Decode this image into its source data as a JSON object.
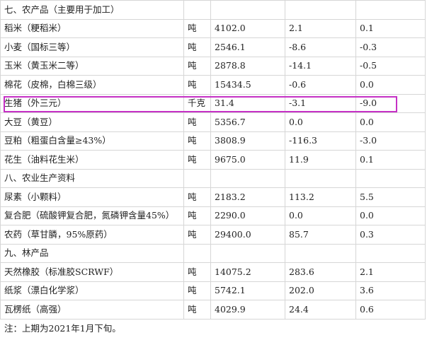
{
  "highlight_color": "#c530c5",
  "rows": [
    {
      "type": "section",
      "name": "七、农产品（主要用于加工）"
    },
    {
      "type": "item",
      "name": "稻米（粳稻米）",
      "unit": "吨",
      "price": "4102.0",
      "change": "2.1",
      "pct": "0.1"
    },
    {
      "type": "item",
      "name": "小麦（国标三等）",
      "unit": "吨",
      "price": "2546.1",
      "change": "-8.6",
      "pct": "-0.3"
    },
    {
      "type": "item",
      "name": "玉米（黄玉米二等）",
      "unit": "吨",
      "price": "2878.8",
      "change": "-14.1",
      "pct": "-0.5"
    },
    {
      "type": "item",
      "name": "棉花（皮棉，白棉三级）",
      "unit": "吨",
      "price": "15434.5",
      "change": "-0.6",
      "pct": "0.0"
    },
    {
      "type": "item",
      "name": "生猪（外三元）",
      "unit": "千克",
      "price": "31.4",
      "change": "-3.1",
      "pct": "-9.0",
      "highlighted": true
    },
    {
      "type": "item",
      "name": "大豆（黄豆）",
      "unit": "吨",
      "price": "5356.7",
      "change": "0.0",
      "pct": "0.0"
    },
    {
      "type": "item",
      "name": "豆粕（粗蛋白含量≥43%）",
      "unit": "吨",
      "price": "3808.9",
      "change": "-116.3",
      "pct": "-3.0"
    },
    {
      "type": "item",
      "name": "花生（油料花生米）",
      "unit": "吨",
      "price": "9675.0",
      "change": "11.9",
      "pct": "0.1"
    },
    {
      "type": "section",
      "name": "八、农业生产资料"
    },
    {
      "type": "item",
      "name": "尿素（小颗料）",
      "unit": "吨",
      "price": "2183.2",
      "change": "113.2",
      "pct": "5.5"
    },
    {
      "type": "item",
      "name": "复合肥（硫酸钾复合肥，氮磷钾含量45%）",
      "unit": "吨",
      "price": "2290.0",
      "change": "0.0",
      "pct": "0.0"
    },
    {
      "type": "item",
      "name": "农药（草甘膦，95%原药）",
      "unit": "吨",
      "price": "29400.0",
      "change": "85.7",
      "pct": "0.3"
    },
    {
      "type": "section",
      "name": "九、林产品"
    },
    {
      "type": "item",
      "name": "天然橡胶（标准胶SCRWF）",
      "unit": "吨",
      "price": "14075.2",
      "change": "283.6",
      "pct": "2.1"
    },
    {
      "type": "item",
      "name": "纸浆（漂白化学浆）",
      "unit": "吨",
      "price": "5742.1",
      "change": "202.0",
      "pct": "3.6"
    },
    {
      "type": "item",
      "name": "瓦楞纸（高强）",
      "unit": "吨",
      "price": "4029.9",
      "change": "24.4",
      "pct": "0.6"
    }
  ],
  "note": "注：上期为2021年1月下旬。"
}
